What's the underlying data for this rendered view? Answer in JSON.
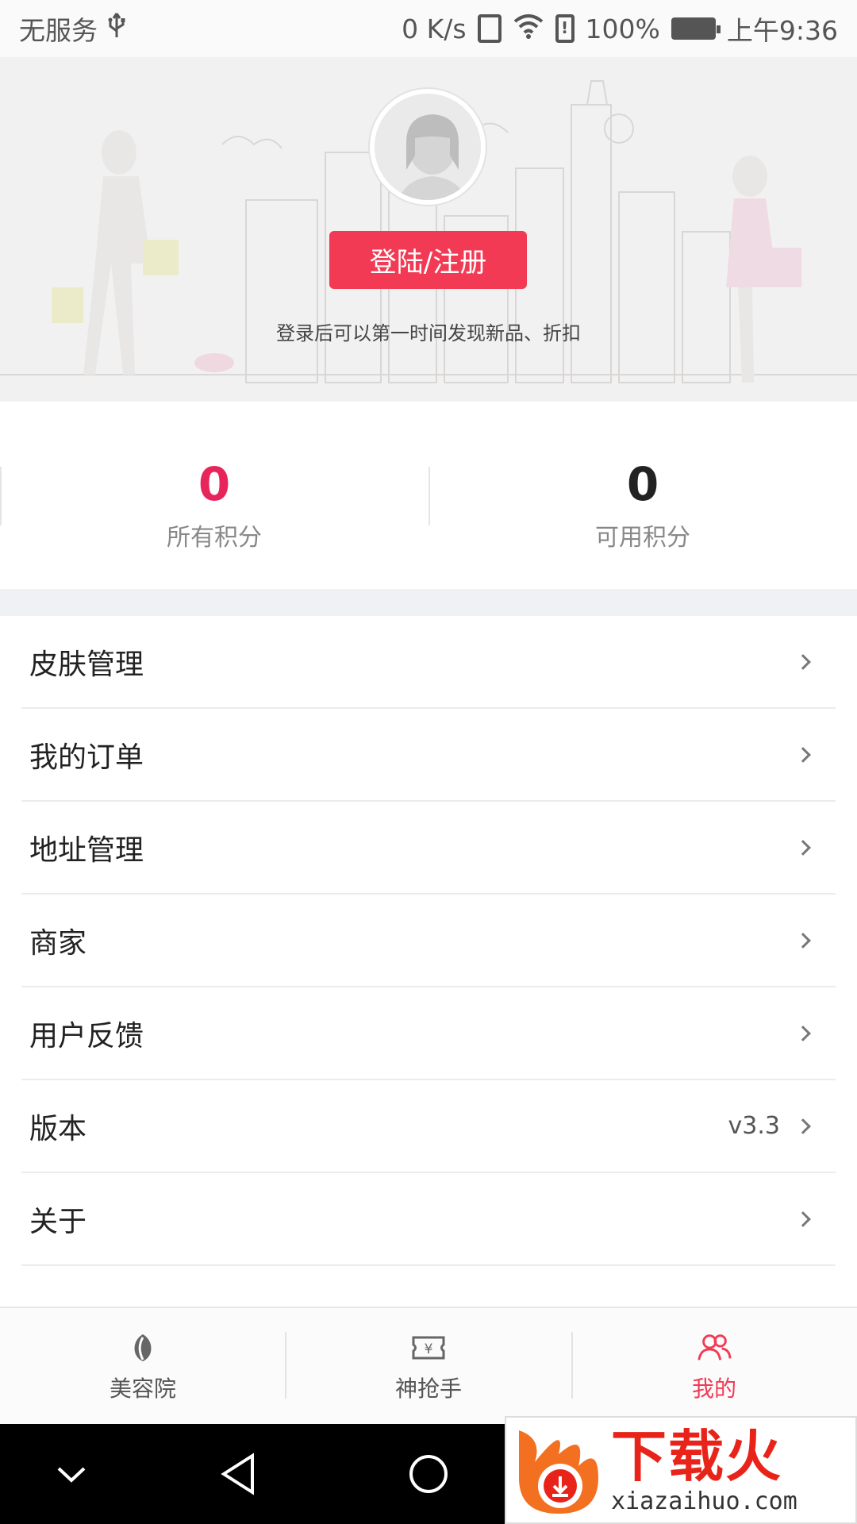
{
  "status_bar": {
    "carrier": "无服务",
    "speed": "0 K/s",
    "battery": "100%",
    "time": "上午9:36"
  },
  "header": {
    "login_button": "登陆/注册",
    "hint": "登录后可以第一时间发现新品、折扣"
  },
  "points": {
    "all": {
      "value": "0",
      "label": "所有积分"
    },
    "available": {
      "value": "0",
      "label": "可用积分"
    }
  },
  "menu": {
    "items": [
      {
        "label": "皮肤管理",
        "value": ""
      },
      {
        "label": "我的订单",
        "value": ""
      },
      {
        "label": "地址管理",
        "value": ""
      },
      {
        "label": "商家",
        "value": ""
      },
      {
        "label": "用户反馈",
        "value": ""
      },
      {
        "label": "版本",
        "value": "v3.3"
      },
      {
        "label": "关于",
        "value": ""
      }
    ]
  },
  "tabs": [
    {
      "label": "美容院",
      "icon": "beauty-leaf-icon",
      "active": false
    },
    {
      "label": "神抢手",
      "icon": "ticket-yen-icon",
      "active": false
    },
    {
      "label": "我的",
      "icon": "users-icon",
      "active": true
    }
  ],
  "watermark": {
    "cn": "下载火",
    "en": "xiazaihuo.com"
  },
  "colors": {
    "accent": "#f23a55",
    "points_pink": "#e8255a",
    "divider": "#ececec",
    "gap_bg": "#f0f1f4"
  }
}
